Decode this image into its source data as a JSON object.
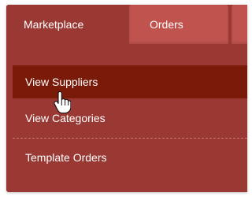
{
  "tabs": [
    {
      "label": "Marketplace",
      "active": true
    },
    {
      "label": "Orders",
      "active": false
    }
  ],
  "menu": {
    "items": [
      {
        "label": "View Suppliers",
        "hovered": true
      },
      {
        "label": "View Categories",
        "hovered": false
      },
      {
        "label": "Template Orders",
        "hovered": false
      }
    ]
  },
  "colors": {
    "menu_background": "#9a3833",
    "inactive_tab": "#c0534d",
    "hovered_item": "#7a1a09",
    "text": "#ffffff",
    "divider": "#c97570"
  },
  "icons": {
    "cursor": "hand-pointer-icon"
  }
}
